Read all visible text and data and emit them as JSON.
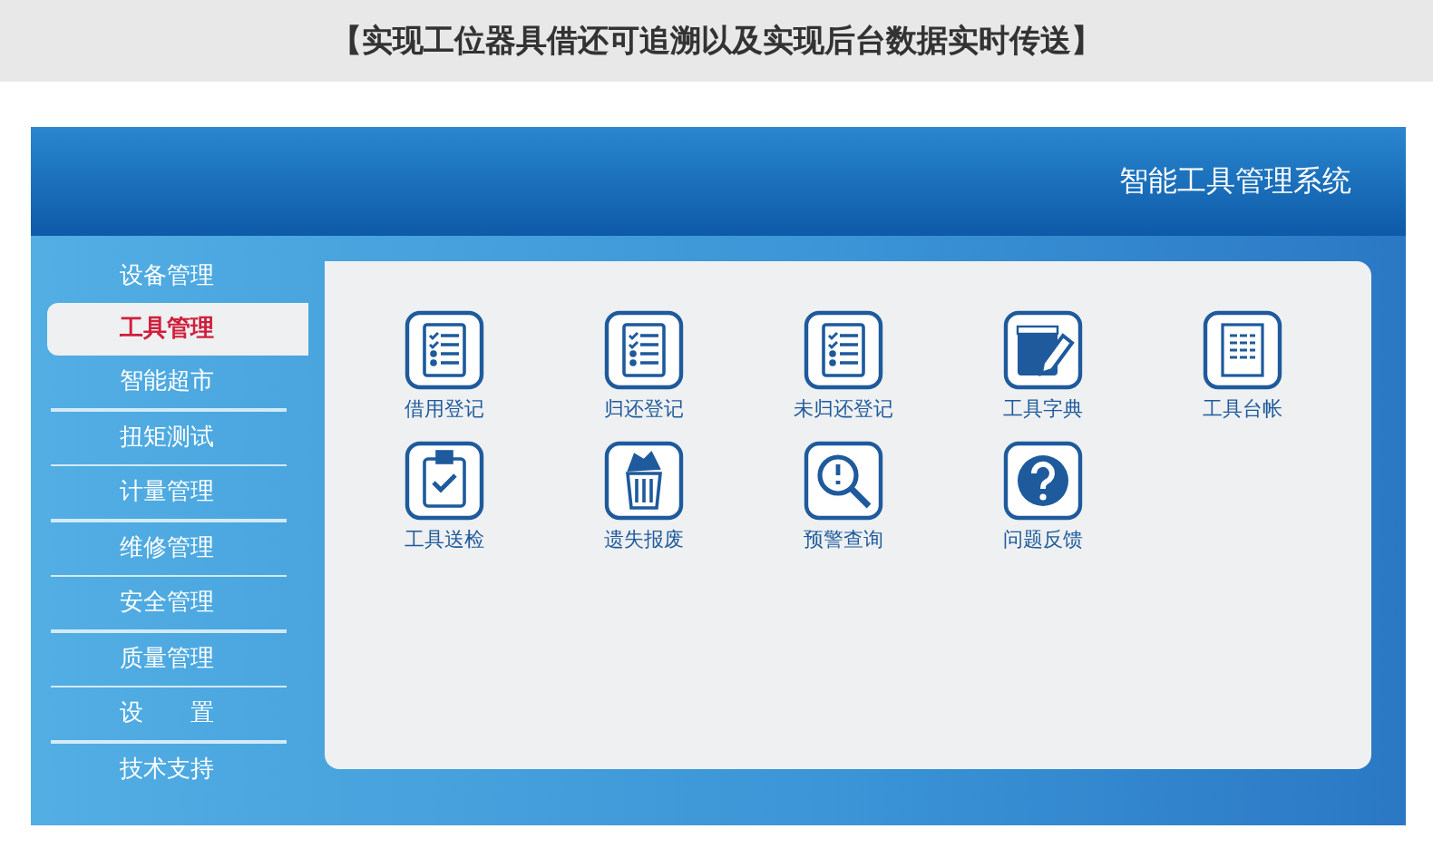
{
  "banner": {
    "text": "【实现工位器具借还可追溯以及实现后台数据实时传送】"
  },
  "window": {
    "title": "智能工具管理系统"
  },
  "sidebar": {
    "items": [
      {
        "label": "设备管理",
        "selected": false
      },
      {
        "label": "工具管理",
        "selected": true
      },
      {
        "label": "智能超市",
        "selected": false
      },
      {
        "label": "扭矩测试",
        "selected": false
      },
      {
        "label": "计量管理",
        "selected": false
      },
      {
        "label": "维修管理",
        "selected": false
      },
      {
        "label": "安全管理",
        "selected": false
      },
      {
        "label": "质量管理",
        "selected": false
      },
      {
        "label": "设　　置",
        "selected": false
      },
      {
        "label": "技术支持",
        "selected": false
      }
    ]
  },
  "tiles": [
    {
      "label": "借用登记",
      "kind": "checklist"
    },
    {
      "label": "归还登记",
      "kind": "checklist"
    },
    {
      "label": "未归还登记",
      "kind": "checklist"
    },
    {
      "label": "工具字典",
      "kind": "book"
    },
    {
      "label": "工具台帐",
      "kind": "ledger"
    },
    {
      "label": "工具送检",
      "kind": "clipboard"
    },
    {
      "label": "遗失报废",
      "kind": "trash"
    },
    {
      "label": "预警查询",
      "kind": "magnifier"
    },
    {
      "label": "问题反馈",
      "kind": "question"
    }
  ]
}
